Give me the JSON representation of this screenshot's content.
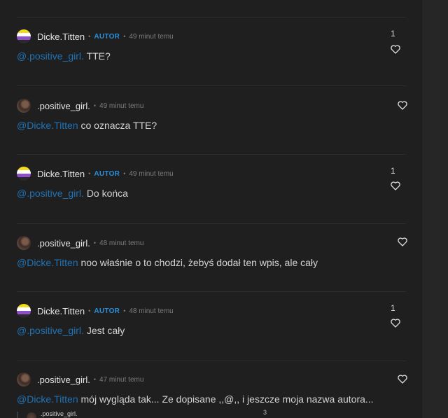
{
  "comments": [
    {
      "author": "Dicke.Titten",
      "badge": "AUTOR",
      "time": "49 minut temu",
      "mention": "@.positive_girl.",
      "text": "TTE?",
      "likes": "1",
      "avatar": "flag"
    },
    {
      "author": ".positive_girl.",
      "badge": "",
      "time": "49 minut temu",
      "mention": "@Dicke.Titten",
      "text": "co oznacza TTE?",
      "likes": "",
      "avatar": "photo"
    },
    {
      "author": "Dicke.Titten",
      "badge": "AUTOR",
      "time": "49 minut temu",
      "mention": "@.positive_girl.",
      "text": "Do końca",
      "likes": "1",
      "avatar": "flag"
    },
    {
      "author": ".positive_girl.",
      "badge": "",
      "time": "48 minut temu",
      "mention": "@Dicke.Titten",
      "text": "noo właśnie o to chodzi, żebyś dodał ten wpis, ale cały",
      "likes": "",
      "avatar": "photo"
    },
    {
      "author": "Dicke.Titten",
      "badge": "AUTOR",
      "time": "48 minut temu",
      "mention": "@.positive_girl.",
      "text": "Jest cały",
      "likes": "1",
      "avatar": "flag"
    },
    {
      "author": ".positive_girl.",
      "badge": "",
      "time": "47 minut temu",
      "mention": "@Dicke.Titten",
      "text": "mój wygląda tak... Ze dopisane ,,@,, i jeszcze moja nazwa autora...",
      "likes": "",
      "avatar": "photo"
    }
  ],
  "quote": {
    "author": ".positive_girl.",
    "count": "3"
  },
  "icons": {
    "like": "heart-icon"
  },
  "colors": {
    "mention": "#1e73b8",
    "badge": "#2a8fd8",
    "background": "#1f1f1f"
  }
}
